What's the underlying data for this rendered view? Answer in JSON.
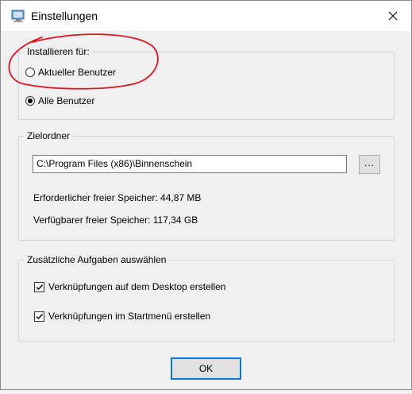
{
  "window": {
    "title": "Einstellungen",
    "close_glyph": "✕"
  },
  "install_for": {
    "title": "Installieren für:",
    "options": [
      {
        "label": "Aktueller Benutzer",
        "checked": false
      },
      {
        "label": "Alle Benutzer",
        "checked": true
      }
    ]
  },
  "target_folder": {
    "title": "Zielordner",
    "path_value": "C:\\Program Files (x86)\\Binnenschein",
    "browse_label": "...",
    "required_space": "Erforderlicher freier Speicher: 44,87 MB",
    "available_space": "Verfügbarer freier Speicher: 117,34 GB"
  },
  "tasks": {
    "title": "Zusätzliche Aufgaben auswählen",
    "items": [
      {
        "label": "Verknüpfungen auf dem Desktop erstellen",
        "checked": true
      },
      {
        "label": "Verknüpfungen im Startmenü erstellen",
        "checked": true
      }
    ]
  },
  "footer": {
    "ok_label": "OK"
  },
  "colors": {
    "accent": "#0078d7",
    "annotation": "#e0141e",
    "background": "#f0f0f0"
  },
  "icons": [
    "app-settings-icon",
    "close-icon",
    "checkmark-icon"
  ]
}
